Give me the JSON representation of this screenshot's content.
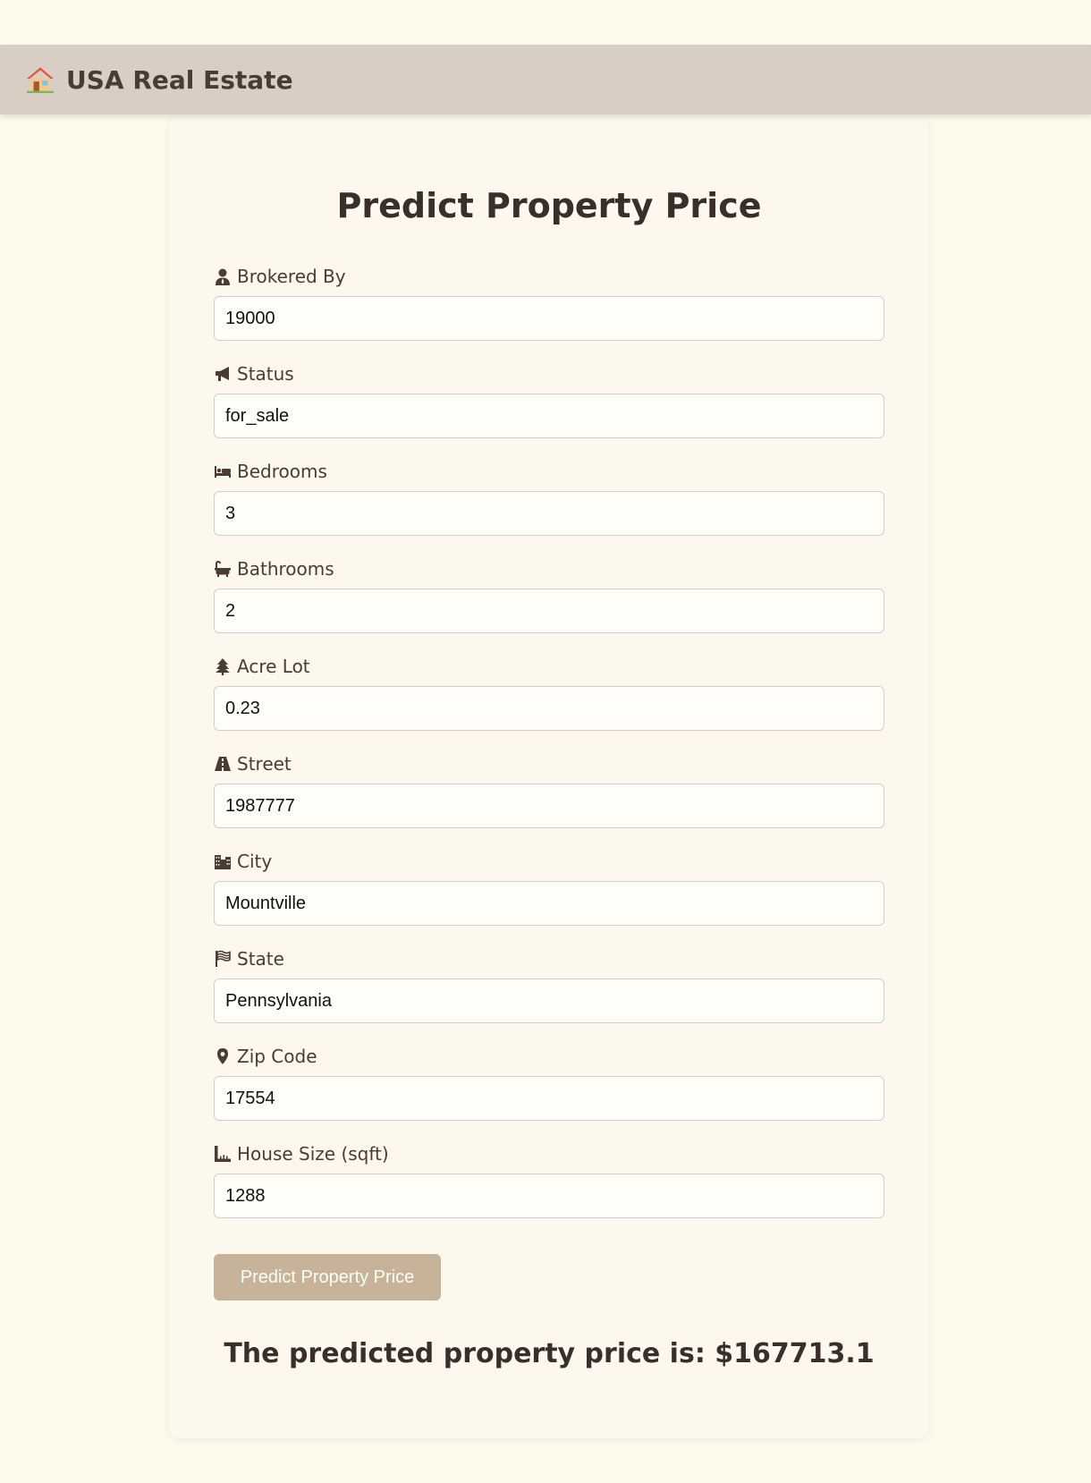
{
  "navbar": {
    "icon": "house-icon",
    "title": "USA Real Estate"
  },
  "form": {
    "title": "Predict Property Price",
    "fields": [
      {
        "label": "Brokered By",
        "icon": "user-tie-icon",
        "value": "19000"
      },
      {
        "label": "Status",
        "icon": "bullhorn-icon",
        "value": "for_sale"
      },
      {
        "label": "Bedrooms",
        "icon": "bed-icon",
        "value": "3"
      },
      {
        "label": "Bathrooms",
        "icon": "bath-icon",
        "value": "2"
      },
      {
        "label": "Acre Lot",
        "icon": "tree-icon",
        "value": "0.23"
      },
      {
        "label": "Street",
        "icon": "road-icon",
        "value": "1987777"
      },
      {
        "label": "City",
        "icon": "city-icon",
        "value": "Mountville"
      },
      {
        "label": "State",
        "icon": "flag-icon",
        "value": "Pennsylvania"
      },
      {
        "label": "Zip Code",
        "icon": "map-marker-icon",
        "value": "17554"
      },
      {
        "label": "House Size (sqft)",
        "icon": "ruler-icon",
        "value": "1288"
      }
    ],
    "submit_label": "Predict Property Price"
  },
  "result": {
    "text": "The predicted property price is: $167713.1"
  },
  "colors": {
    "page_background": "#fdfcec",
    "navbar_background": "#d8cec3",
    "card_background": "#fcf8ee",
    "button_background": "#c6b39a",
    "text_primary": "#4a3b33"
  }
}
